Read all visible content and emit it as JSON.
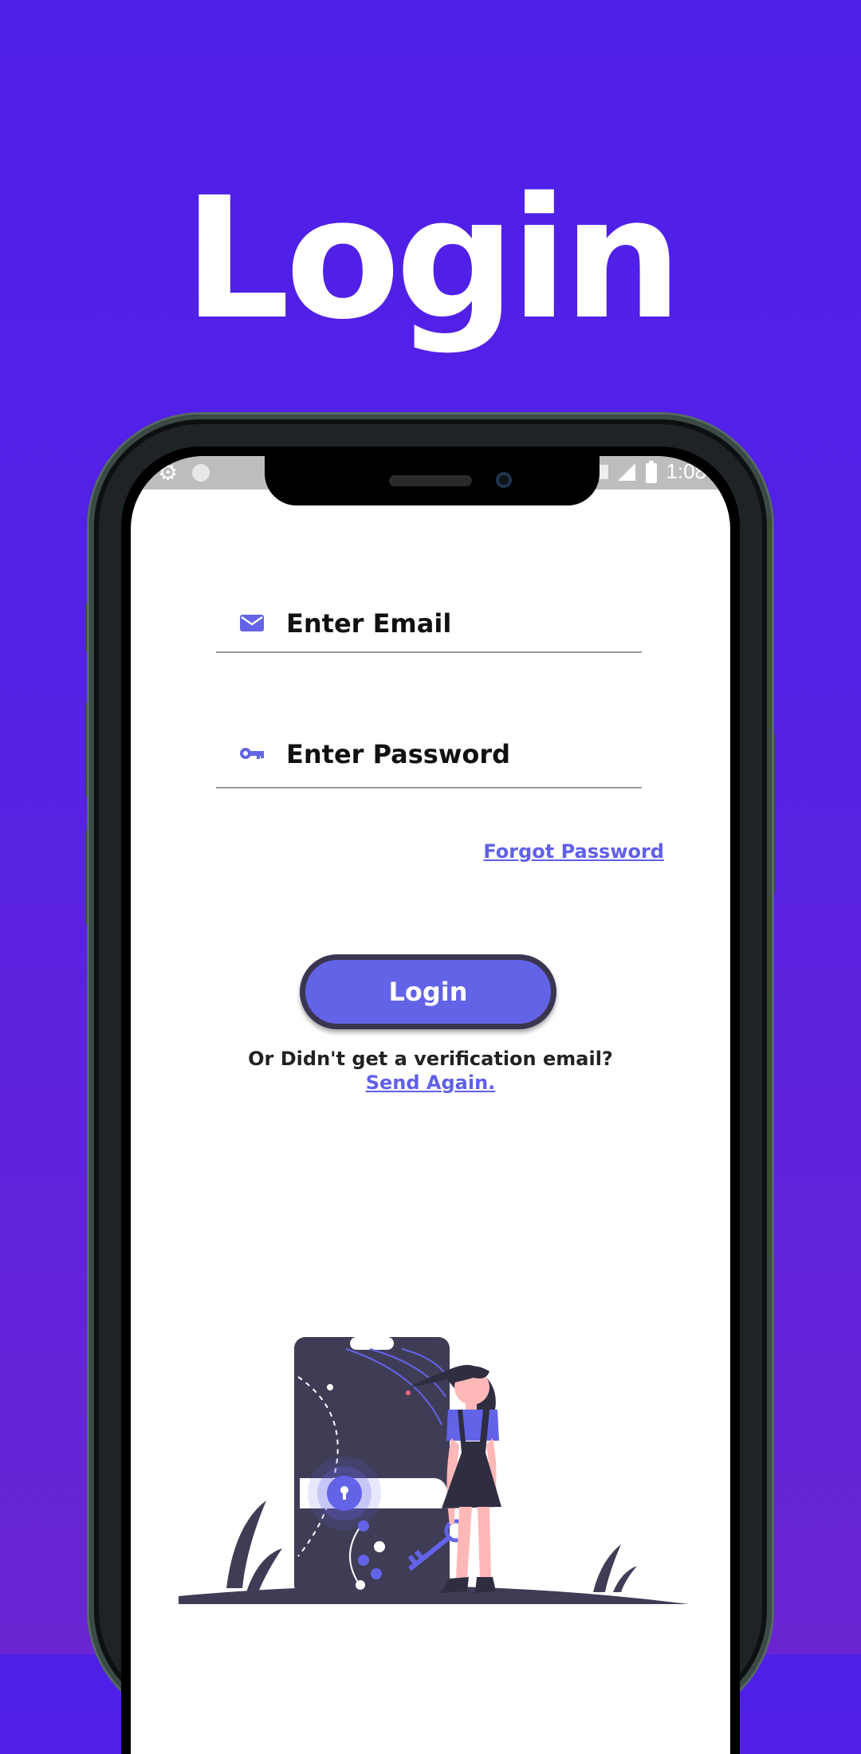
{
  "hero": {
    "title": "Login"
  },
  "status_bar": {
    "time": "1:08"
  },
  "form": {
    "email_placeholder": "Enter Email",
    "password_placeholder": "Enter Password",
    "forgot_password": "Forgot Password",
    "login_button": "Login",
    "verification_prompt": "Or Didn't get a verification email?",
    "send_again": "Send Again."
  },
  "colors": {
    "background": "#4f1fea",
    "accent": "#6363e8",
    "button_border": "#3a3650",
    "illustration_dark": "#3f3d56"
  },
  "icons": [
    "settings-icon",
    "notification-dot-icon",
    "wifi-icon",
    "signal-icon",
    "battery-icon",
    "email-icon",
    "key-icon",
    "lock-icon"
  ]
}
